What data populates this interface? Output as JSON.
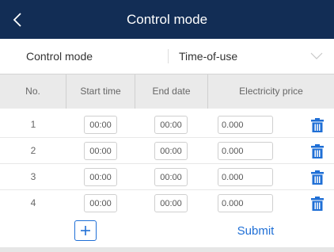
{
  "header": {
    "title": "Control mode",
    "back_icon": "chevron-left-icon"
  },
  "mode": {
    "label": "Control mode",
    "value": "Time-of-use",
    "dropdown_icon": "chevron-down-icon"
  },
  "table": {
    "columns": [
      "No.",
      "Start time",
      "End date",
      "Electricity price"
    ],
    "rows": [
      {
        "no": "1",
        "start": "00:00",
        "end": "00:00",
        "price": "0.000"
      },
      {
        "no": "2",
        "start": "00:00",
        "end": "00:00",
        "price": "0.000"
      },
      {
        "no": "3",
        "start": "00:00",
        "end": "00:00",
        "price": "0.000"
      },
      {
        "no": "4",
        "start": "00:00",
        "end": "00:00",
        "price": "0.000"
      }
    ],
    "delete_icon": "trash-icon"
  },
  "footer": {
    "add_icon": "plus-icon",
    "submit_label": "Submit"
  },
  "colors": {
    "header_bg": "#122d55",
    "accent": "#1f6fd6",
    "table_header_bg": "#eaeaea"
  }
}
